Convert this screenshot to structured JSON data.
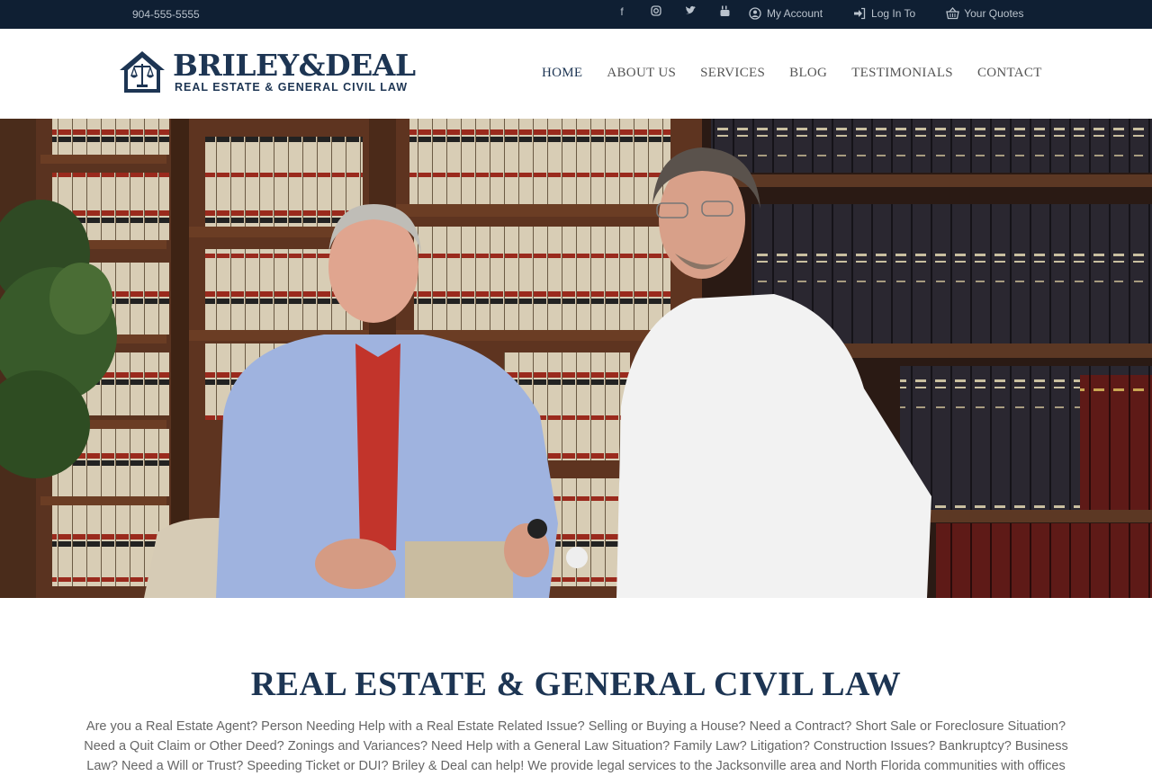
{
  "topbar": {
    "phone": "904-555-5555",
    "social_icons": [
      "facebook-icon",
      "instagram-icon",
      "twitter-icon",
      "youtube-icon"
    ],
    "links": [
      {
        "icon": "user-icon",
        "label": "My Account"
      },
      {
        "icon": "sign-in-icon",
        "label": "Log In To"
      },
      {
        "icon": "basket-icon",
        "label": "Your Quotes"
      }
    ]
  },
  "header": {
    "logo_name": "BRILEY&DEAL",
    "logo_tagline": "REAL ESTATE & GENERAL CIVIL LAW",
    "nav": [
      "HOME",
      "ABOUT US",
      "SERVICES",
      "BLOG",
      "TESTIMONIALS",
      "CONTACT"
    ],
    "active_nav": "HOME"
  },
  "hero": {
    "description": "",
    "slide_indicator_count": 1
  },
  "content": {
    "heading": "REAL ESTATE & GENERAL CIVIL LAW",
    "body": "Are you a Real Estate Agent? Person Needing Help with a Real Estate Related Issue? Selling or Buying a House? Need a Contract? Short Sale or Foreclosure Situation? Need a Quit Claim or Other Deed? Zonings and Variances? Need Help with a General Law Situation? Family Law? Litigation? Construction Issues? Bankruptcy? Business Law? Need a Will or Trust? Speeding Ticket or DUI? Briley & Deal can help! We provide legal services to the Jacksonville area and North Florida communities with offices"
  },
  "colors": {
    "topbar_bg": "#0f1f33",
    "brand_navy": "#1d3553",
    "text_gray": "#666666"
  }
}
